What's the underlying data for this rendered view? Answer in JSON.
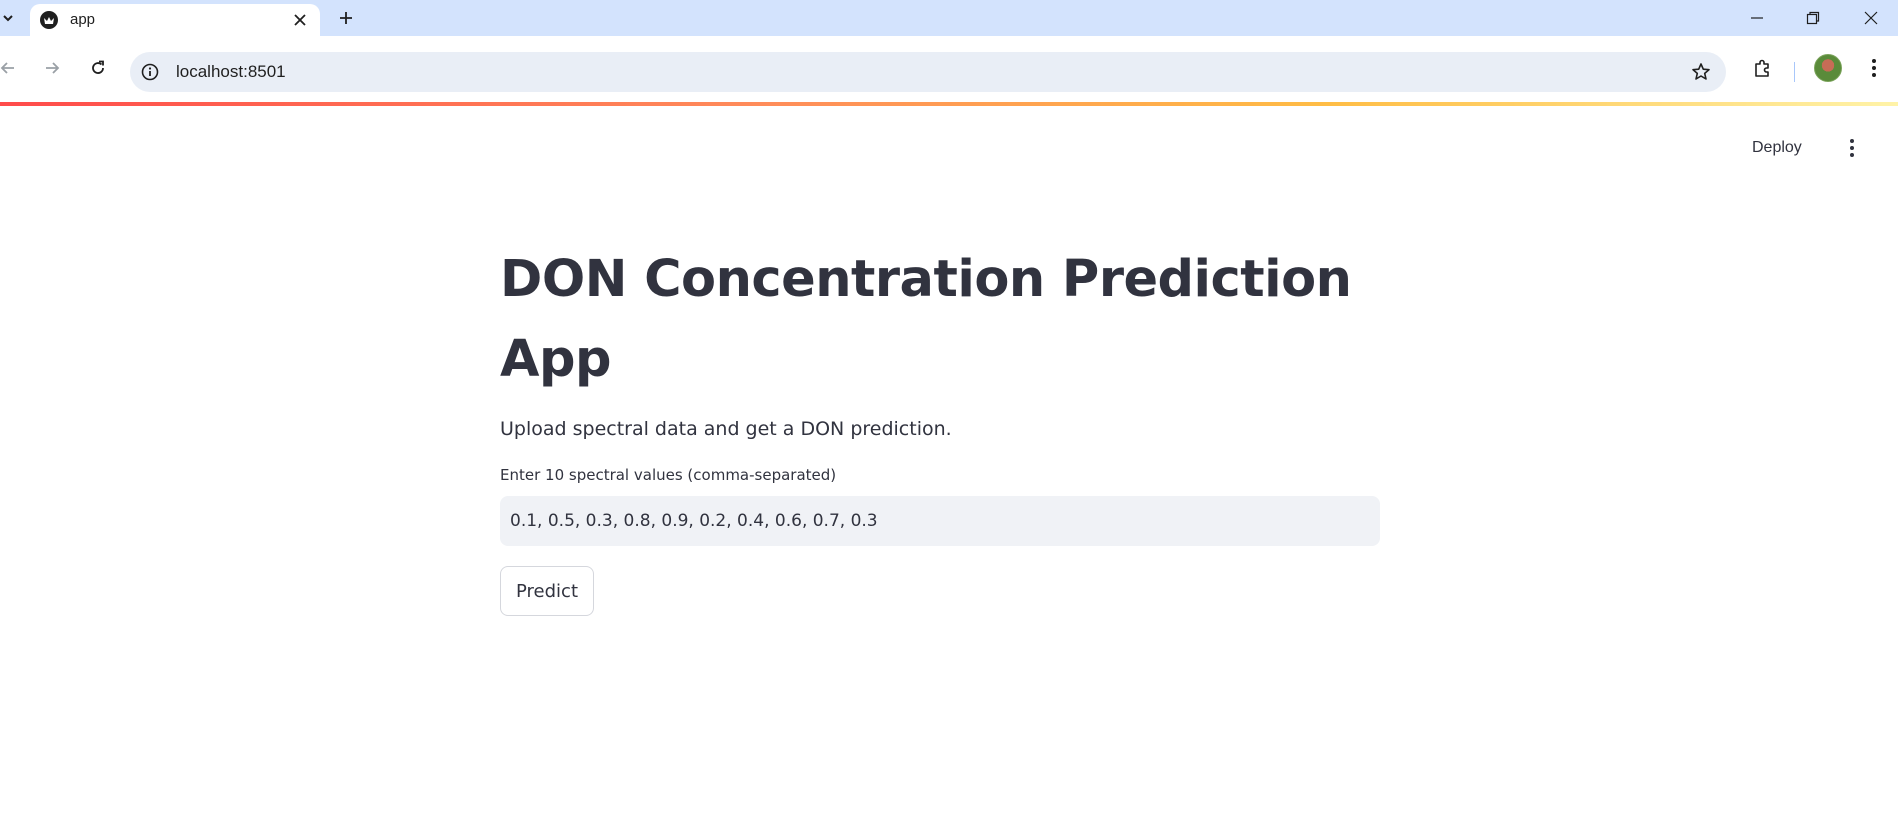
{
  "browser": {
    "tab": {
      "title": "app"
    },
    "address_bar": {
      "url": "localhost:8501"
    }
  },
  "app": {
    "header": {
      "deploy_label": "Deploy"
    },
    "title": "DON Concentration Prediction App",
    "subtitle": "Upload spectral data and get a DON prediction.",
    "input": {
      "label": "Enter 10 spectral values (comma-separated)",
      "value": "0.1, 0.5, 0.3, 0.8, 0.9, 0.2, 0.4, 0.6, 0.7, 0.3"
    },
    "predict_label": "Predict"
  },
  "colors": {
    "tabbar_bg": "#d3e3fd",
    "omnibox_bg": "#e9eef6",
    "input_bg": "#f0f2f6",
    "text": "#31333f",
    "accent": "#ff4b4b"
  }
}
